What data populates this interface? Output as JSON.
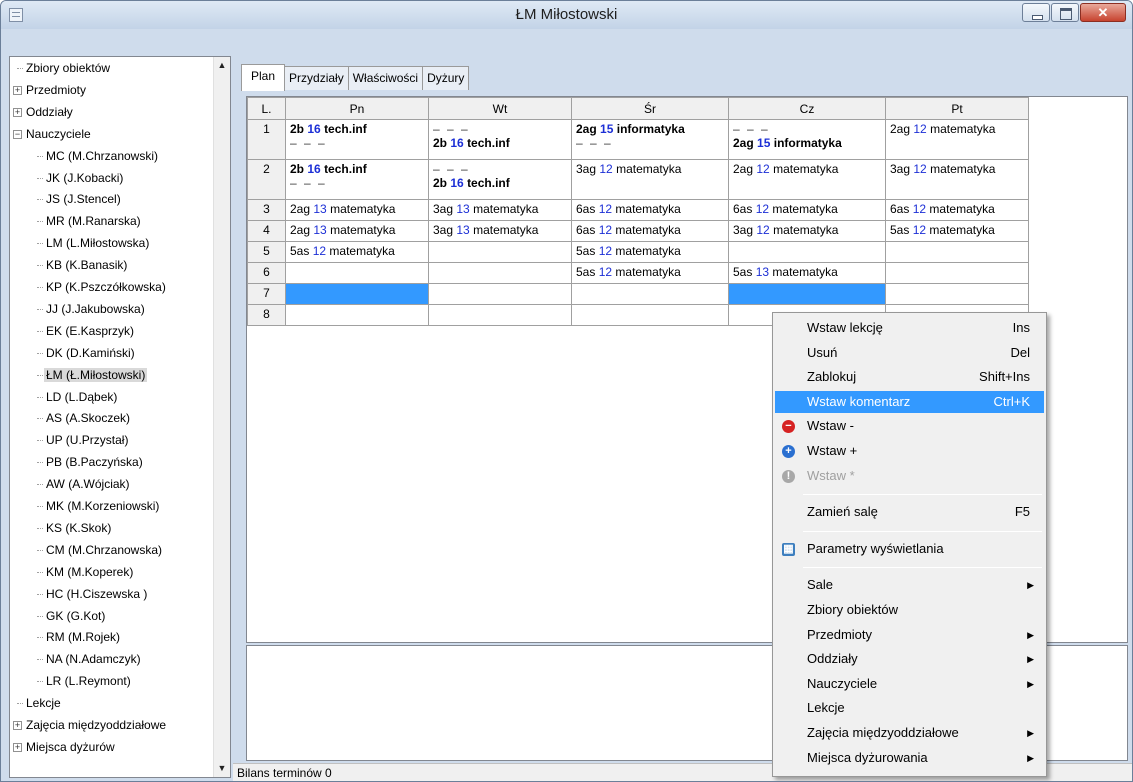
{
  "window": {
    "title": "ŁM Miłostowski"
  },
  "tree": {
    "items": [
      {
        "label": "Zbiory obiektów",
        "expander": "",
        "indent": 0
      },
      {
        "label": "Przedmioty",
        "expander": "+",
        "indent": 0
      },
      {
        "label": "Oddziały",
        "expander": "+",
        "indent": 0
      },
      {
        "label": "Nauczyciele",
        "expander": "−",
        "indent": 0
      },
      {
        "label": "MC (M.Chrzanowski)",
        "indent": 1
      },
      {
        "label": "JK (J.Kobacki)",
        "indent": 1
      },
      {
        "label": "JS (J.Stencel)",
        "indent": 1
      },
      {
        "label": "MR (M.Ranarska)",
        "indent": 1
      },
      {
        "label": "LM (L.Miłostowska)",
        "indent": 1
      },
      {
        "label": "KB (K.Banasik)",
        "indent": 1
      },
      {
        "label": "KP (K.Pszczółkowska)",
        "indent": 1
      },
      {
        "label": "JJ (J.Jakubowska)",
        "indent": 1
      },
      {
        "label": "EK (E.Kasprzyk)",
        "indent": 1
      },
      {
        "label": "DK (D.Kamiński)",
        "indent": 1
      },
      {
        "label": "ŁM (Ł.Miłostowski)",
        "indent": 1,
        "selected": true
      },
      {
        "label": "LD (L.Dąbek)",
        "indent": 1
      },
      {
        "label": "AS (A.Skoczek)",
        "indent": 1
      },
      {
        "label": "UP (U.Przystał)",
        "indent": 1
      },
      {
        "label": "PB (B.Paczyńska)",
        "indent": 1
      },
      {
        "label": "AW (A.Wójciak)",
        "indent": 1
      },
      {
        "label": "MK (M.Korzeniowski)",
        "indent": 1
      },
      {
        "label": "KS (K.Skok)",
        "indent": 1
      },
      {
        "label": "CM (M.Chrzanowska)",
        "indent": 1
      },
      {
        "label": "KM (M.Koperek)",
        "indent": 1
      },
      {
        "label": "HC (H.Ciszewska )",
        "indent": 1
      },
      {
        "label": "GK (G.Kot)",
        "indent": 1
      },
      {
        "label": "RM (M.Rojek)",
        "indent": 1
      },
      {
        "label": "NA (N.Adamczyk)",
        "indent": 1
      },
      {
        "label": "LR (L.Reymont)",
        "indent": 1
      },
      {
        "label": "Lekcje",
        "expander": "",
        "indent": 0
      },
      {
        "label": "Zajęcia międzyoddziałowe",
        "expander": "+",
        "indent": 0
      },
      {
        "label": "Miejsca dyżurów",
        "expander": "+",
        "indent": 0
      }
    ]
  },
  "tabs": [
    "Plan",
    "Przydziały",
    "Właściwości",
    "Dyżury"
  ],
  "plan": {
    "headers": [
      "L.",
      "Pn",
      "Wt",
      "Śr",
      "Cz",
      "Pt"
    ],
    "rows": [
      {
        "n": "1",
        "cells": [
          {
            "cls": "2b",
            "room": "16",
            "subj": "tech.inf",
            "bold": true,
            "dash_below": true
          },
          {
            "cls": "2b",
            "room": "16",
            "subj": "tech.inf",
            "bold": true,
            "dash_above": true
          },
          {
            "cls": "2ag",
            "room": "15",
            "subj": "informatyka",
            "bold": true,
            "dash_below": true
          },
          {
            "cls": "2ag",
            "room": "15",
            "subj": "informatyka",
            "bold": true,
            "dash_above": true
          },
          {
            "cls": "2ag",
            "room": "12",
            "subj": "matematyka"
          }
        ]
      },
      {
        "n": "2",
        "cells": [
          {
            "cls": "2b",
            "room": "16",
            "subj": "tech.inf",
            "bold": true,
            "dash_below": true
          },
          {
            "cls": "2b",
            "room": "16",
            "subj": "tech.inf",
            "bold": true,
            "dash_above": true
          },
          {
            "cls": "3ag",
            "room": "12",
            "subj": "matematyka"
          },
          {
            "cls": "2ag",
            "room": "12",
            "subj": "matematyka"
          },
          {
            "cls": "3ag",
            "room": "12",
            "subj": "matematyka"
          }
        ]
      },
      {
        "n": "3",
        "cells": [
          {
            "cls": "2ag",
            "room": "13",
            "subj": "matematyka"
          },
          {
            "cls": "3ag",
            "room": "13",
            "subj": "matematyka"
          },
          {
            "cls": "6as",
            "room": "12",
            "subj": "matematyka"
          },
          {
            "cls": "6as",
            "room": "12",
            "subj": "matematyka"
          },
          {
            "cls": "6as",
            "room": "12",
            "subj": "matematyka"
          }
        ]
      },
      {
        "n": "4",
        "cells": [
          {
            "cls": "2ag",
            "room": "13",
            "subj": "matematyka"
          },
          {
            "cls": "3ag",
            "room": "13",
            "subj": "matematyka"
          },
          {
            "cls": "6as",
            "room": "12",
            "subj": "matematyka"
          },
          {
            "cls": "3ag",
            "room": "12",
            "subj": "matematyka"
          },
          {
            "cls": "5as",
            "room": "12",
            "subj": "matematyka"
          }
        ]
      },
      {
        "n": "5",
        "cells": [
          {
            "cls": "5as",
            "room": "12",
            "subj": "matematyka"
          },
          null,
          {
            "cls": "5as",
            "room": "12",
            "subj": "matematyka"
          },
          null,
          null
        ]
      },
      {
        "n": "6",
        "cells": [
          null,
          null,
          {
            "cls": "5as",
            "room": "12",
            "subj": "matematyka"
          },
          {
            "cls": "5as",
            "room": "13",
            "subj": "matematyka"
          },
          null
        ]
      },
      {
        "n": "7",
        "cells": [
          "selected",
          null,
          null,
          "selected",
          null
        ]
      },
      {
        "n": "8",
        "cells": [
          null,
          null,
          null,
          null,
          null
        ]
      }
    ],
    "dash_text": "– – –"
  },
  "status": {
    "text": "Bilans terminów 0"
  },
  "context_menu": {
    "items": [
      {
        "label": "Wstaw lekcję",
        "shortcut": "Ins"
      },
      {
        "label": "Usuń",
        "shortcut": "Del"
      },
      {
        "label": "Zablokuj",
        "shortcut": "Shift+Ins"
      },
      {
        "label": "Wstaw komentarz",
        "shortcut": "Ctrl+K",
        "highlighted": true
      },
      {
        "label": "Wstaw -",
        "icon": "minus-circle-icon"
      },
      {
        "label": "Wstaw +",
        "icon": "plus-circle-icon"
      },
      {
        "label": "Wstaw *",
        "icon": "star-circle-icon",
        "disabled": true
      },
      {
        "separator": true
      },
      {
        "label": "Zamień salę",
        "shortcut": "F5"
      },
      {
        "separator": true
      },
      {
        "label": "Parametry wyświetlania",
        "icon": "display-settings-icon"
      },
      {
        "separator": true
      },
      {
        "label": "Sale",
        "submenu": true
      },
      {
        "label": "Zbiory obiektów"
      },
      {
        "label": "Przedmioty",
        "submenu": true
      },
      {
        "label": "Oddziały",
        "submenu": true
      },
      {
        "label": "Nauczyciele",
        "submenu": true
      },
      {
        "label": "Lekcje"
      },
      {
        "label": "Zajęcia międzyoddziałowe",
        "submenu": true
      },
      {
        "label": "Miejsca dyżurowania",
        "submenu": true
      }
    ]
  },
  "colors": {
    "accent": "#3399ff",
    "room_number": "#1c2fd6"
  }
}
